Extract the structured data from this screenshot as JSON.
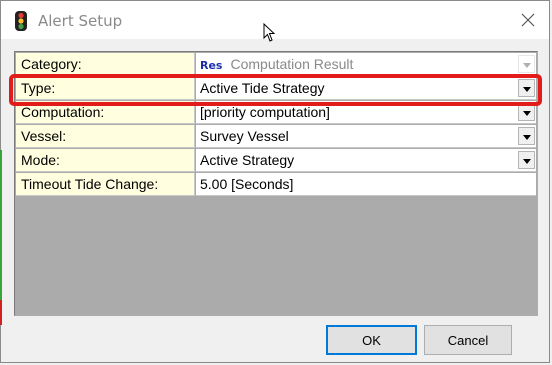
{
  "window": {
    "title": "Alert Setup",
    "app_icon": "traffic-light-icon"
  },
  "grid": {
    "rows": [
      {
        "label": "Category:",
        "tag": "Res",
        "value": "Computation Result",
        "disabled": true,
        "dropdown": true
      },
      {
        "label": "Type:",
        "value": "Active Tide Strategy",
        "dropdown": true
      },
      {
        "label": "Computation:",
        "value": "[priority computation]",
        "dropdown": true
      },
      {
        "label": "Vessel:",
        "value": "Survey Vessel",
        "dropdown": true
      },
      {
        "label": "Mode:",
        "value": "Active Strategy",
        "dropdown": true
      },
      {
        "label": "Timeout Tide Change:",
        "value": "5.00 [Seconds]",
        "dropdown": false
      }
    ]
  },
  "buttons": {
    "ok_label": "OK",
    "cancel_label": "Cancel"
  },
  "colors": {
    "label_bg": "#ffffe0",
    "highlight": "#e21b1b",
    "res_tag": "#1b2ea8"
  }
}
